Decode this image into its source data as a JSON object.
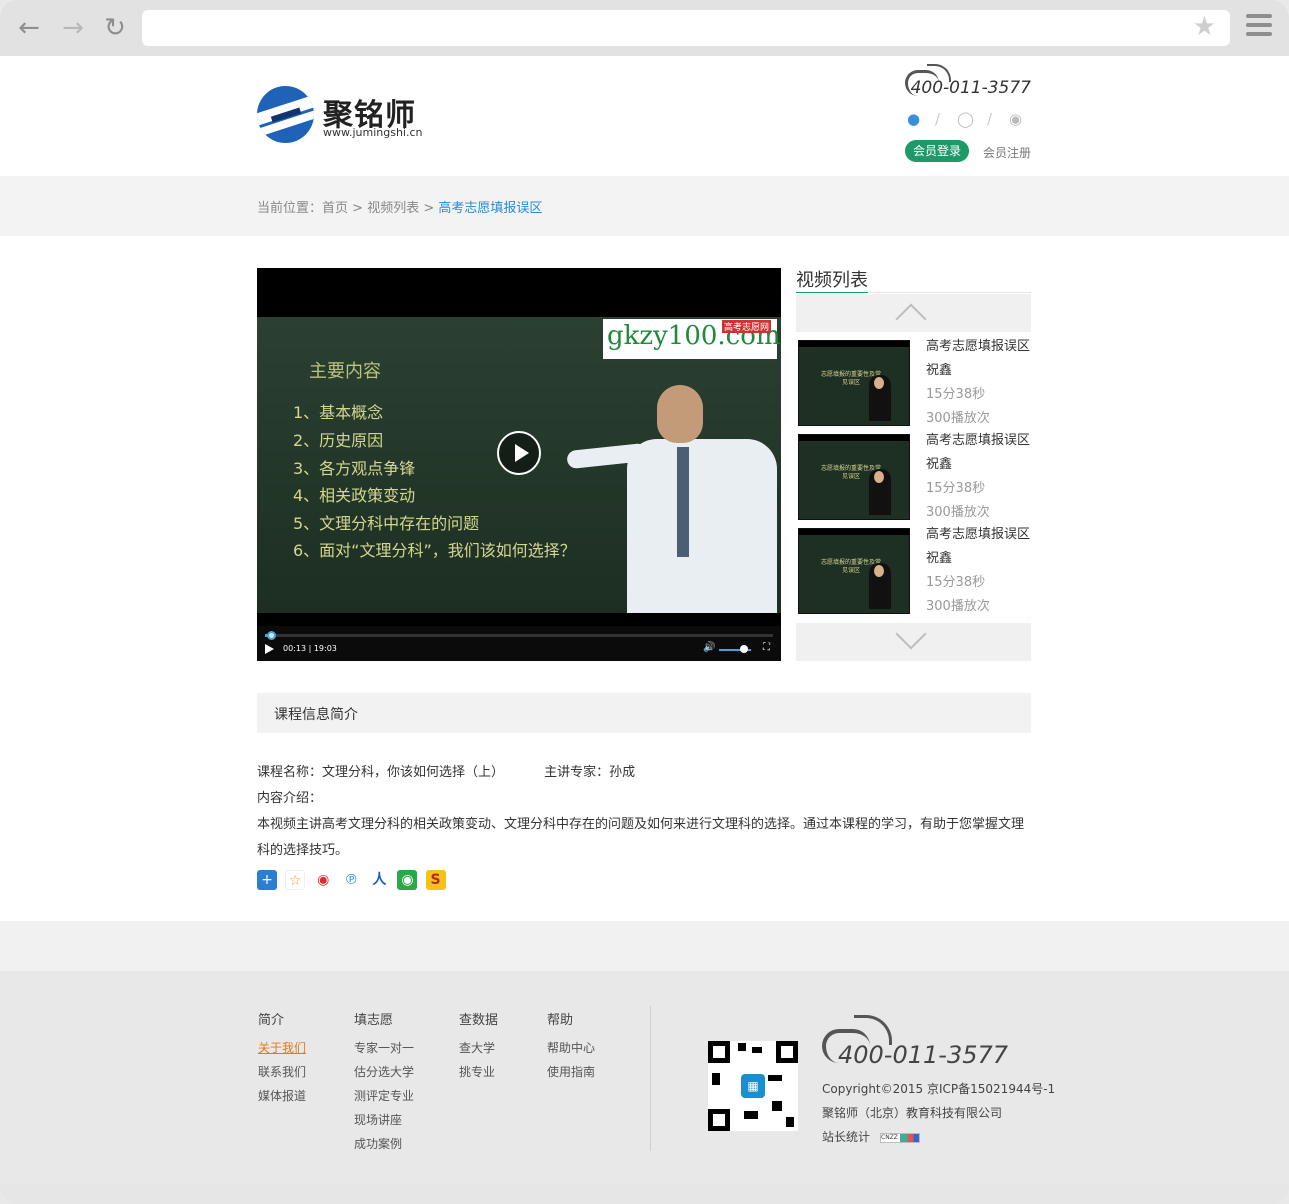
{
  "browser": {
    "back_icon": "arrow-left-icon",
    "forward_icon": "arrow-right-icon",
    "reload_icon": "reload-icon",
    "url": "",
    "bookmark_icon": "star-icon",
    "menu_icon": "hamburger-icon"
  },
  "header": {
    "logo_title": "聚铭师",
    "logo_url": "www.jumingshi.cn",
    "hotline": "400-011-3577",
    "social_icons": [
      "qq-icon",
      "weibo-icon",
      "wechat-icon"
    ],
    "login_label": "会员登录",
    "register_label": "会员注册"
  },
  "breadcrumb": {
    "prefix": "当前位置：",
    "home": "首页",
    "sep1": " > ",
    "list": "视频列表",
    "sep2": " > ",
    "current": "高考志愿填报误区"
  },
  "player": {
    "board_title": "主要内容",
    "board_lines": [
      "1、基本概念",
      "2、历史原因",
      "3、各方观点争锋",
      "4、相关政策变动",
      "5、文理分科中存在的问题",
      "6、面对“文理分科”，我们该如何选择？"
    ],
    "watermark_main": "gkzy100.com",
    "watermark_badge": "高考志愿网",
    "time": "00:13 | 19:03",
    "progress": 0.011
  },
  "sidebar": {
    "title": "视频列表",
    "items": [
      {
        "title": "高考志愿填报误区",
        "author": "祝鑫",
        "duration": "15分38秒",
        "plays": "300播放次",
        "thumb_text": "志愿填报的重要性及常见误区"
      },
      {
        "title": "高考志愿填报误区",
        "author": "祝鑫",
        "duration": "15分38秒",
        "plays": "300播放次",
        "thumb_text": "志愿填报的重要性及常见误区"
      },
      {
        "title": "高考志愿填报误区",
        "author": "祝鑫",
        "duration": "15分38秒",
        "plays": "300播放次",
        "thumb_text": "志愿填报的重要性及常见误区"
      }
    ]
  },
  "course": {
    "section_title": "课程信息简介",
    "name_label": "课程名称：文理分科，你该如何选择（上）",
    "expert_label": "主讲专家：孙成",
    "intro_label": "内容介绍：",
    "intro_text": "本视频主讲高考文理分科的相关政策变动、文理分科中存在的问题及如何来进行文理科的选择。通过本课程的学习，有助于您掌握文理科的选择技巧。",
    "share_icons": [
      "share-plus-icon",
      "favorite-icon",
      "weibo-icon",
      "tencent-icon",
      "renren-icon",
      "wechat-icon",
      "sohu-icon"
    ]
  },
  "footer": {
    "columns": [
      {
        "heading": "简介",
        "links": [
          "关于我们",
          "联系我们",
          "媒体报道"
        ]
      },
      {
        "heading": "填志愿",
        "links": [
          "专家一对一",
          "估分选大学",
          "测评定专业",
          "现场讲座",
          "成功案例"
        ]
      },
      {
        "heading": "查数据",
        "links": [
          "查大学",
          "挑专业"
        ]
      },
      {
        "heading": "帮助",
        "links": [
          "帮助中心",
          "使用指南"
        ]
      }
    ],
    "hotline": "400-011-3577",
    "copyright": "Copyright©2015 京ICP备15021944号-1",
    "company": "聚铭师（北京）教育科技有限公司",
    "stats_label": "站长统计",
    "stats_badge": "CNZZ"
  }
}
